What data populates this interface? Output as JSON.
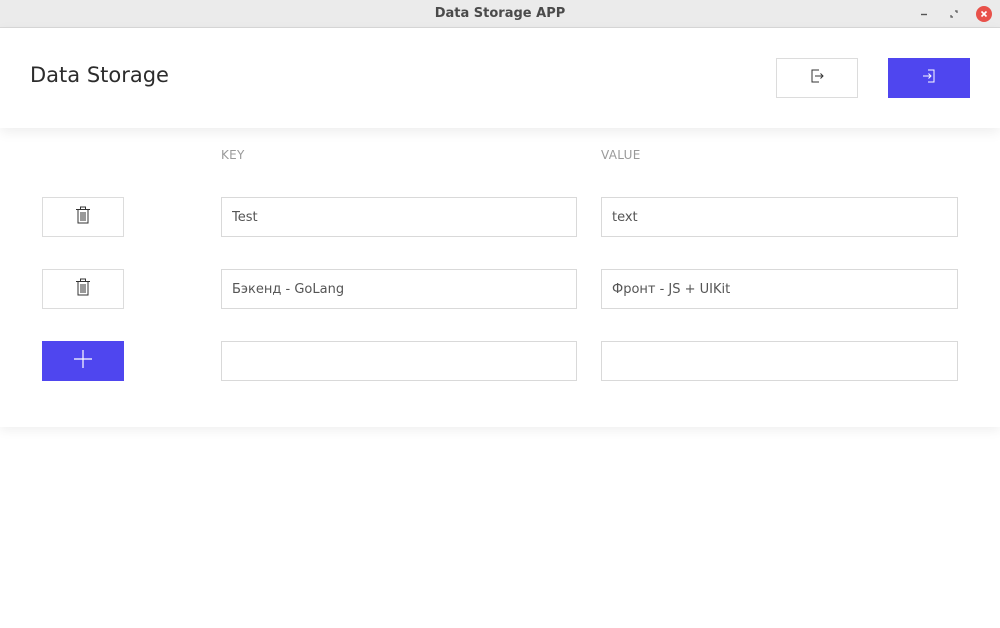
{
  "window": {
    "title": "Data Storage APP",
    "controls": [
      "minimize-icon",
      "restore-icon",
      "close-icon"
    ]
  },
  "header": {
    "title": "Data Storage",
    "export_icon": "export-icon",
    "import_icon": "import-icon"
  },
  "table": {
    "columns": {
      "key": "KEY",
      "value": "VALUE"
    },
    "rows": [
      {
        "key": "Test",
        "value": "text",
        "action_icon": "trash-icon"
      },
      {
        "key": "Бэкенд - GoLang",
        "value": "Фронт - JS + UIKit",
        "action_icon": "trash-icon"
      }
    ],
    "new_row": {
      "key": "",
      "value": "",
      "action_icon": "plus-icon"
    }
  },
  "colors": {
    "accent": "#4f46ef",
    "titlebar": "#ebebeb",
    "close": "#e8514a",
    "border": "#dcdcdc",
    "muted_text": "#9a9a9a"
  }
}
